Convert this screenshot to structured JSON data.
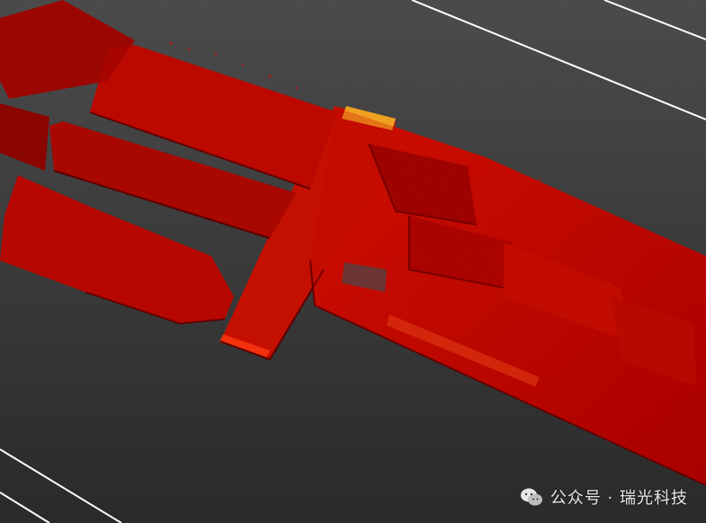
{
  "viewer": {
    "view": "point-cloud-3d-view",
    "background_colors": [
      "#4b4b4b",
      "#2a2a2a"
    ],
    "point_cloud_colors": [
      "#b00000",
      "#e01a00",
      "#7a0000",
      "#ff5a10",
      "#ffb020"
    ],
    "grid_line_color": "#ffffff"
  },
  "watermark": {
    "icon": "wechat-icon",
    "text": "公众号 · 瑞光科技"
  }
}
